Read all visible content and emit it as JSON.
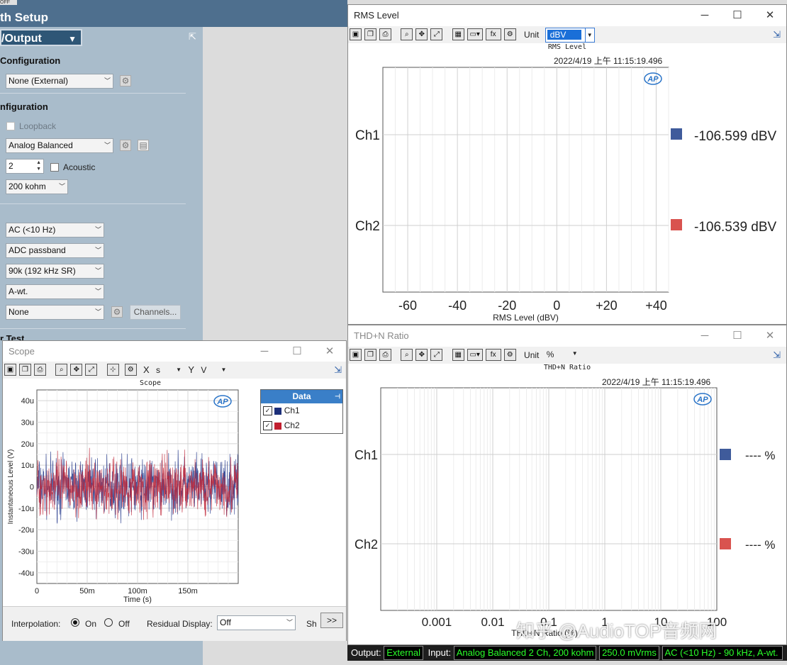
{
  "left_panel": {
    "off_badge": "OFF",
    "title": "th Setup",
    "io_selector": "/Output",
    "section1": "Configuration",
    "output_config": "None (External)",
    "section2": "nfiguration",
    "loopback_label": "Loopback",
    "input_connector": "Analog Balanced",
    "channels_value": "2",
    "acoustic_label": "Acoustic",
    "impedance": "200 kohm",
    "coupling": "AC (<10 Hz)",
    "bandwidth": "ADC passband",
    "filter_cutoff": "90k (192 kHz SR)",
    "weighting": "A-wt.",
    "extra_filter": "None",
    "channels_button": "Channels...",
    "section3": "r Test"
  },
  "rms_window": {
    "title": "RMS Level",
    "unit_label": "Unit",
    "unit_value": "dBV",
    "chart_title": "RMS Level",
    "timestamp": "2022/4/19 上午 11:15:19.496",
    "logo": "AP",
    "channels": [
      "Ch1",
      "Ch2"
    ],
    "readouts": [
      "-106.599  dBV",
      "-106.539  dBV"
    ],
    "x_ticks": [
      "-60",
      "-40",
      "-20",
      "0",
      "+20",
      "+40"
    ],
    "xlabel": "RMS Level (dBV)"
  },
  "thd_window": {
    "title": "THD+N Ratio",
    "unit_label": "Unit",
    "unit_value": "%",
    "chart_title": "THD+N Ratio",
    "timestamp": "2022/4/19 上午 11:15:19.496",
    "logo": "AP",
    "channels": [
      "Ch1",
      "Ch2"
    ],
    "readouts": [
      "----  %",
      "----  %"
    ],
    "x_ticks": [
      "0.001",
      "0.01",
      "0.1",
      "1",
      "10",
      "100"
    ],
    "xlabel": "THD+N Ratio (%)"
  },
  "scope_window": {
    "title": "Scope",
    "x_axis_label": "X",
    "x_unit": "s",
    "y_axis_label": "Y",
    "y_unit": "V",
    "chart_title": "Scope",
    "logo": "AP",
    "ylabel": "Instantaneous Level (V)",
    "xlabel": "Time (s)",
    "y_ticks": [
      "40u",
      "30u",
      "20u",
      "10u",
      "0",
      "-10u",
      "-20u",
      "-30u",
      "-40u"
    ],
    "x_ticks": [
      "0",
      "50m",
      "100m",
      "150m"
    ],
    "data_panel_title": "Data",
    "data_channels": [
      "Ch1",
      "Ch2"
    ],
    "interp_label": "Interpolation:",
    "interp_on": "On",
    "interp_off": "Off",
    "residual_label": "Residual Display:",
    "residual_value": "Off",
    "sh_label": "Sh",
    "more_button": ">>"
  },
  "status": {
    "output_label": "Output:",
    "output_value": "External",
    "input_label": "Input:",
    "input_value": "Analog Balanced 2 Ch, 200 kohm",
    "level_value": "250.0 mVrms",
    "filter_value": "AC (<10 Hz) - 90 kHz, A-wt."
  },
  "watermark": "知乎 @AudioTOP音频网",
  "colors": {
    "ch1": "#3f5b9b",
    "ch2": "#d9534f",
    "scope_ch1": "#2b3f8f",
    "scope_ch2": "#c0283a"
  },
  "chart_data": [
    {
      "type": "bar",
      "title": "RMS Level",
      "categories": [
        "Ch1",
        "Ch2"
      ],
      "values": [
        -106.599,
        -106.539
      ],
      "xlabel": "RMS Level (dBV)",
      "xlim": [
        -70,
        45
      ],
      "grid": true
    },
    {
      "type": "bar",
      "title": "THD+N Ratio",
      "categories": [
        "Ch1",
        "Ch2"
      ],
      "values": [
        null,
        null
      ],
      "xlabel": "THD+N Ratio (%)",
      "xscale": "log",
      "xlim": [
        0.0001,
        100
      ],
      "grid": true
    },
    {
      "type": "line",
      "title": "Scope",
      "xlabel": "Time (s)",
      "ylabel": "Instantaneous Level (V)",
      "xlim": [
        0,
        0.2
      ],
      "ylim": [
        -4.5e-05,
        4.5e-05
      ],
      "series": [
        {
          "name": "Ch1",
          "amplitude_peak": 1.8e-05
        },
        {
          "name": "Ch2",
          "amplitude_peak": 1.8e-05
        }
      ],
      "grid": true
    }
  ]
}
